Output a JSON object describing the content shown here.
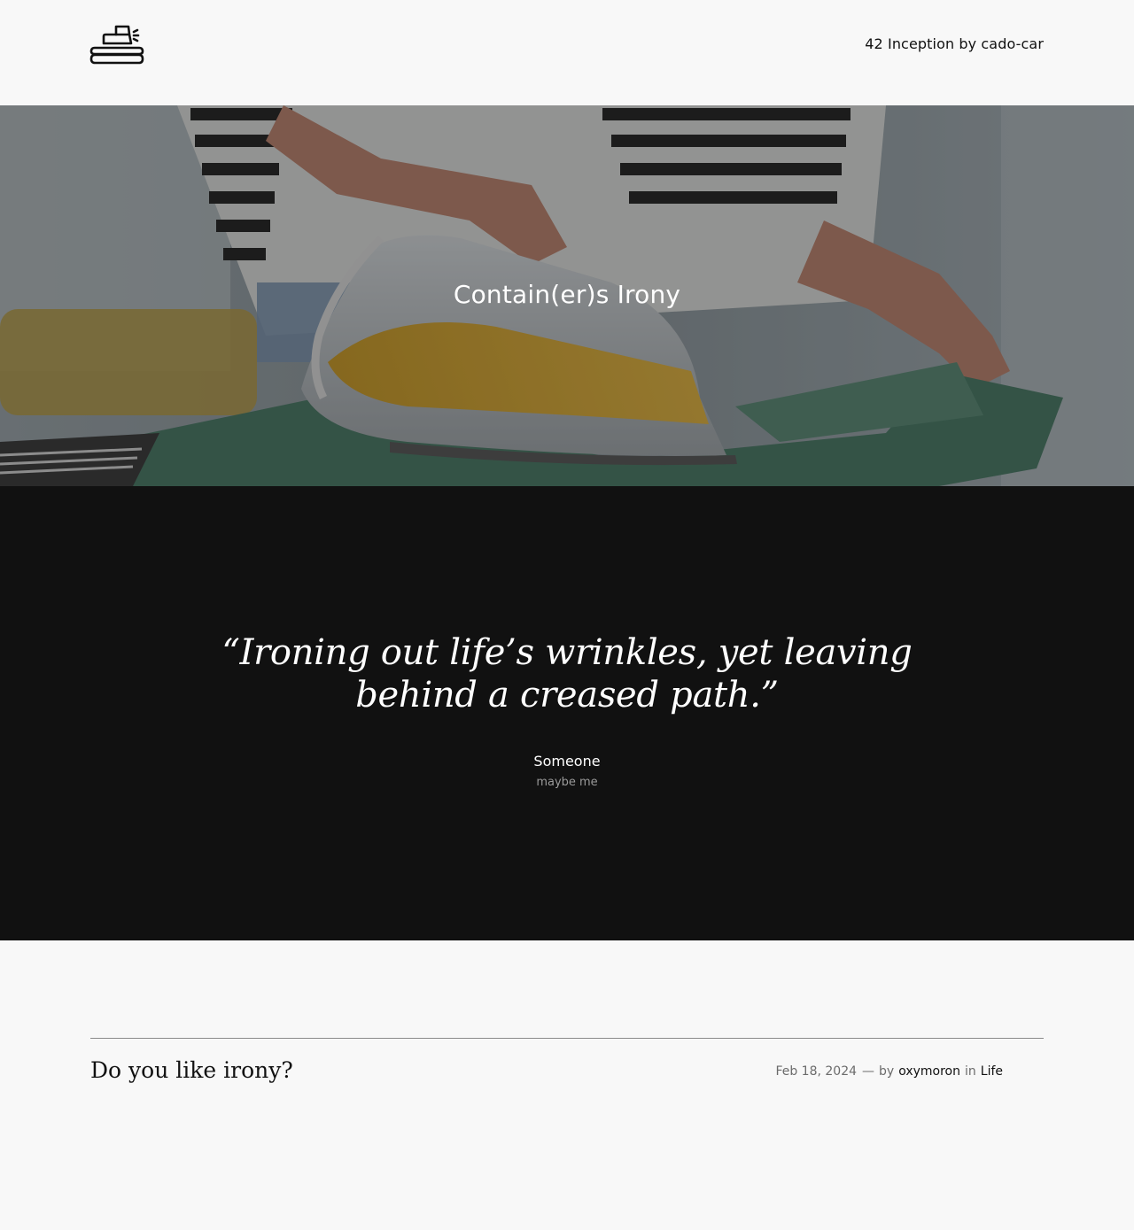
{
  "header": {
    "site_title": "42 Inception by cado-car",
    "logo_icon": "iron-icon"
  },
  "hero": {
    "title": "Contain(er)s Irony",
    "background": "photo-ironing-shirt"
  },
  "quote": {
    "text": "“Ironing out life’s wrinkles, yet leaving behind a creased path.”",
    "author": "Someone",
    "subtitle": "maybe me"
  },
  "post": {
    "title": "Do you like irony?",
    "date": "Feb 18, 2024",
    "separator": "—",
    "by_label": "by",
    "author": "oxymoron",
    "in_label": "in",
    "category": "Life"
  },
  "colors": {
    "page_background": "#f8f8f8",
    "quote_background": "#111111",
    "text": "#111111",
    "muted": "#6b6b6b"
  }
}
